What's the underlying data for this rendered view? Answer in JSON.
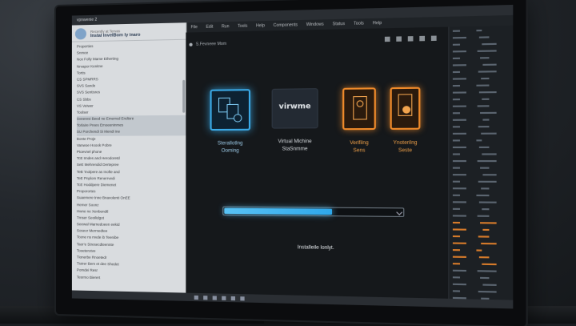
{
  "window": {
    "title": "vpnwenie 2",
    "menu": [
      "File",
      "Edit",
      "Run",
      "Tools",
      "Help",
      "Components",
      "Windows",
      "Status",
      "Tools",
      "Help"
    ]
  },
  "sidebar": {
    "title": "Instal InvelBom ly inaro",
    "subtitle": "Recently at Tervas",
    "items": [
      "Properties",
      "Snmee",
      "Nox Folly Mame Etherting",
      "Nrvapor Kenitne",
      "Tortis",
      "CS SPMRRS",
      "SVS Sande",
      "SVS Sentisres",
      "CS Sbbs",
      "VS Veiwer",
      "Toolser",
      "Sveeresi Beed ne Emerred Endtsre",
      "Torlaire Prees Emoeeninmes",
      "SU Porchendi Si Mendi ine",
      "Bonte Proje",
      "Vanwoe Hoook Pobre",
      "Ptoevnel phone",
      "TcE Imdes and Herodoretd",
      "SeE Mehrendid Dertepree",
      "TeB 'Inolpere as Inofte and",
      "TeE Pnplom Renerrvedi",
      "TcE Hoddpere Diemenet",
      "Proporortes",
      "Suaemere tnne Bnavolenti OnEE",
      "Hemer Soonz",
      "Hwne ne Xenbendtl",
      "Trnser Seoilidgot",
      "Seewal Marnedoeen eekid",
      "Soseor Mermedtee",
      "Tcene ns mvde ib Teenibe",
      "Taor'e Stresecdteennte",
      "Tooeterotve",
      "Tionerbe Rnoetedr",
      "Tioirer Bem et dee Shedet",
      "Pomdei Resr",
      "Tesrmo Bierert"
    ]
  },
  "main": {
    "label": "S.Fevneee Mom",
    "cards": [
      {
        "name": "Sterallotlng",
        "sub": "Ooming"
      },
      {
        "name": "Virtual Mlchine",
        "sub": "StaSnmme",
        "logo": "virwme"
      },
      {
        "name": "Verifilng",
        "sub": "Sens"
      },
      {
        "name": "Ynoterilng",
        "sub": "Seste"
      }
    ],
    "progress": 0.61,
    "status": "Installeile lonlyt."
  },
  "colors": {
    "accent_blue": "#3aa9e6",
    "accent_orange": "#ef8a2a"
  }
}
